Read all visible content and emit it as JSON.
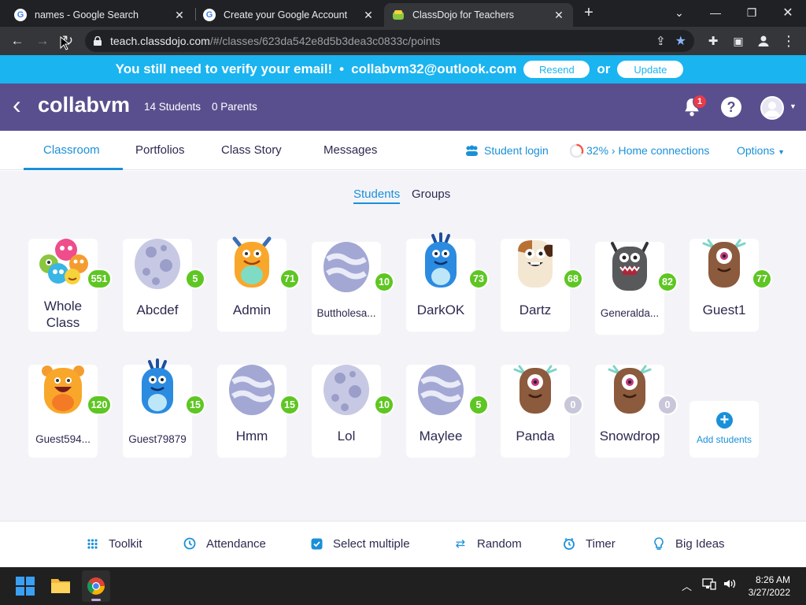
{
  "browser": {
    "tabs": [
      {
        "title": "names - Google Search",
        "close": "✕"
      },
      {
        "title": "Create your Google Account",
        "close": "✕"
      },
      {
        "title": "ClassDojo for Teachers",
        "close": "✕"
      }
    ],
    "new_tab": "+",
    "url_host": "teach.classdojo.com",
    "url_path": "/#/classes/623da542e8d5b3dea3c0833c/points"
  },
  "verify_banner": {
    "message": "You still need to verify your email!",
    "bullet": "•",
    "email": "collabvm32@outlook.com",
    "resend_label": "Resend",
    "or_text": "or",
    "update_label": "Update"
  },
  "class_header": {
    "back": "‹",
    "name": "collabvm",
    "students_count": "14 Students",
    "parents_count": "0 Parents",
    "notification_count": "1",
    "help": "?"
  },
  "nav": {
    "tabs": [
      "Classroom",
      "Portfolios",
      "Class Story",
      "Messages"
    ],
    "student_login": "Student login",
    "home_connections": "32% › Home connections",
    "options": "Options"
  },
  "view_toggle": {
    "students": "Students",
    "groups": "Groups"
  },
  "students": [
    {
      "name": "Whole Class",
      "points": "551",
      "avatar": "group-monsters-avatar"
    },
    {
      "name": "Abcdef",
      "points": "5",
      "avatar": "egg-avatar"
    },
    {
      "name": "Admin",
      "points": "71",
      "avatar": "orange-monster-avatar"
    },
    {
      "name": "Buttholesa...",
      "points": "10",
      "avatar": "egg-avatar"
    },
    {
      "name": "DarkOK",
      "points": "73",
      "avatar": "blue-monster-avatar"
    },
    {
      "name": "Dartz",
      "points": "68",
      "avatar": "cow-monster-avatar"
    },
    {
      "name": "Generalda...",
      "points": "82",
      "avatar": "gray-monster-avatar"
    },
    {
      "name": "Guest1",
      "points": "77",
      "avatar": "one-eyed-monster-avatar"
    },
    {
      "name": "Guest594...",
      "points": "120",
      "avatar": "orange-monster-avatar"
    },
    {
      "name": "Guest79879",
      "points": "15",
      "avatar": "blue-monster-avatar"
    },
    {
      "name": "Hmm",
      "points": "15",
      "avatar": "egg-avatar"
    },
    {
      "name": "Lol",
      "points": "10",
      "avatar": "egg-avatar"
    },
    {
      "name": "Maylee",
      "points": "5",
      "avatar": "egg-avatar"
    },
    {
      "name": "Panda",
      "points": "0",
      "avatar": "one-eyed-monster-avatar"
    },
    {
      "name": "Snowdrop",
      "points": "0",
      "avatar": "one-eyed-monster-avatar"
    }
  ],
  "add_students": "Add students",
  "toolbar": {
    "toolkit": "Toolkit",
    "attendance": "Attendance",
    "select_multiple": "Select multiple",
    "random": "Random",
    "timer": "Timer",
    "big_ideas": "Big Ideas"
  },
  "taskbar": {
    "time": "8:26 AM",
    "date": "3/27/2022"
  },
  "colors": {
    "banner": "#1ab4f0",
    "header": "#5a4f8e",
    "accent": "#1a90d9",
    "points": "#5ec622"
  }
}
